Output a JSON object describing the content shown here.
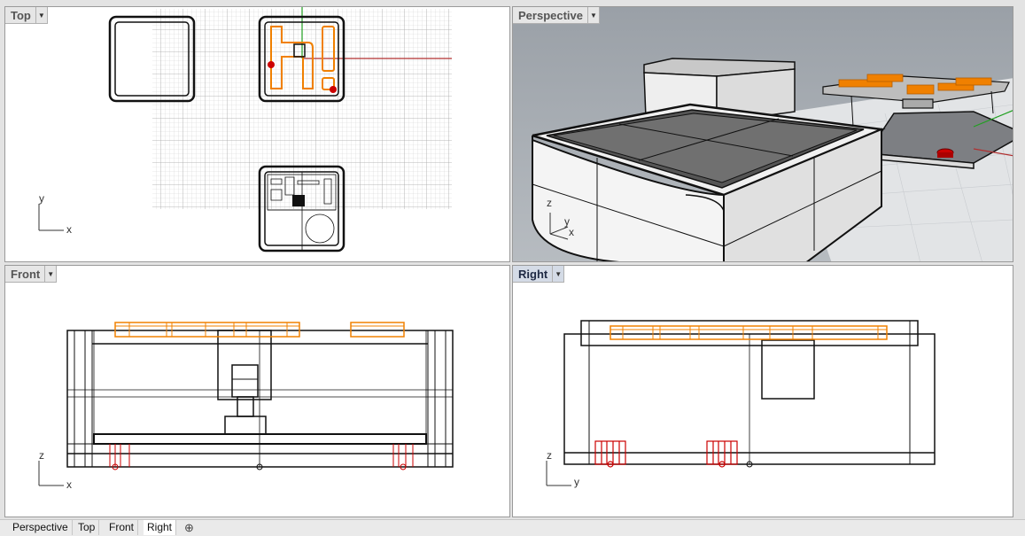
{
  "viewports": {
    "top": {
      "label": "Top",
      "axis_y": "y",
      "axis_x": "x",
      "active": false
    },
    "perspective": {
      "label": "Perspective",
      "axis_z": "z",
      "axis_y": "y",
      "axis_x": "x",
      "active": false
    },
    "front": {
      "label": "Front",
      "axis_z": "z",
      "axis_x": "x",
      "active": false
    },
    "right": {
      "label": "Right",
      "axis_z": "z",
      "axis_y": "y",
      "active": true
    }
  },
  "tabs": [
    {
      "label": "Perspective"
    },
    {
      "label": "Top"
    },
    {
      "label": "Front"
    },
    {
      "label": "Right",
      "active": true
    }
  ],
  "colors": {
    "curve_selected": "#f08000",
    "object_red": "#cc0000",
    "axis_red": "#b03030",
    "axis_green": "#20a020",
    "active_label_bg": "#d4dbe6"
  },
  "icons": {
    "dropdown": "chevron-down-icon",
    "add_tab": "plus-icon"
  }
}
